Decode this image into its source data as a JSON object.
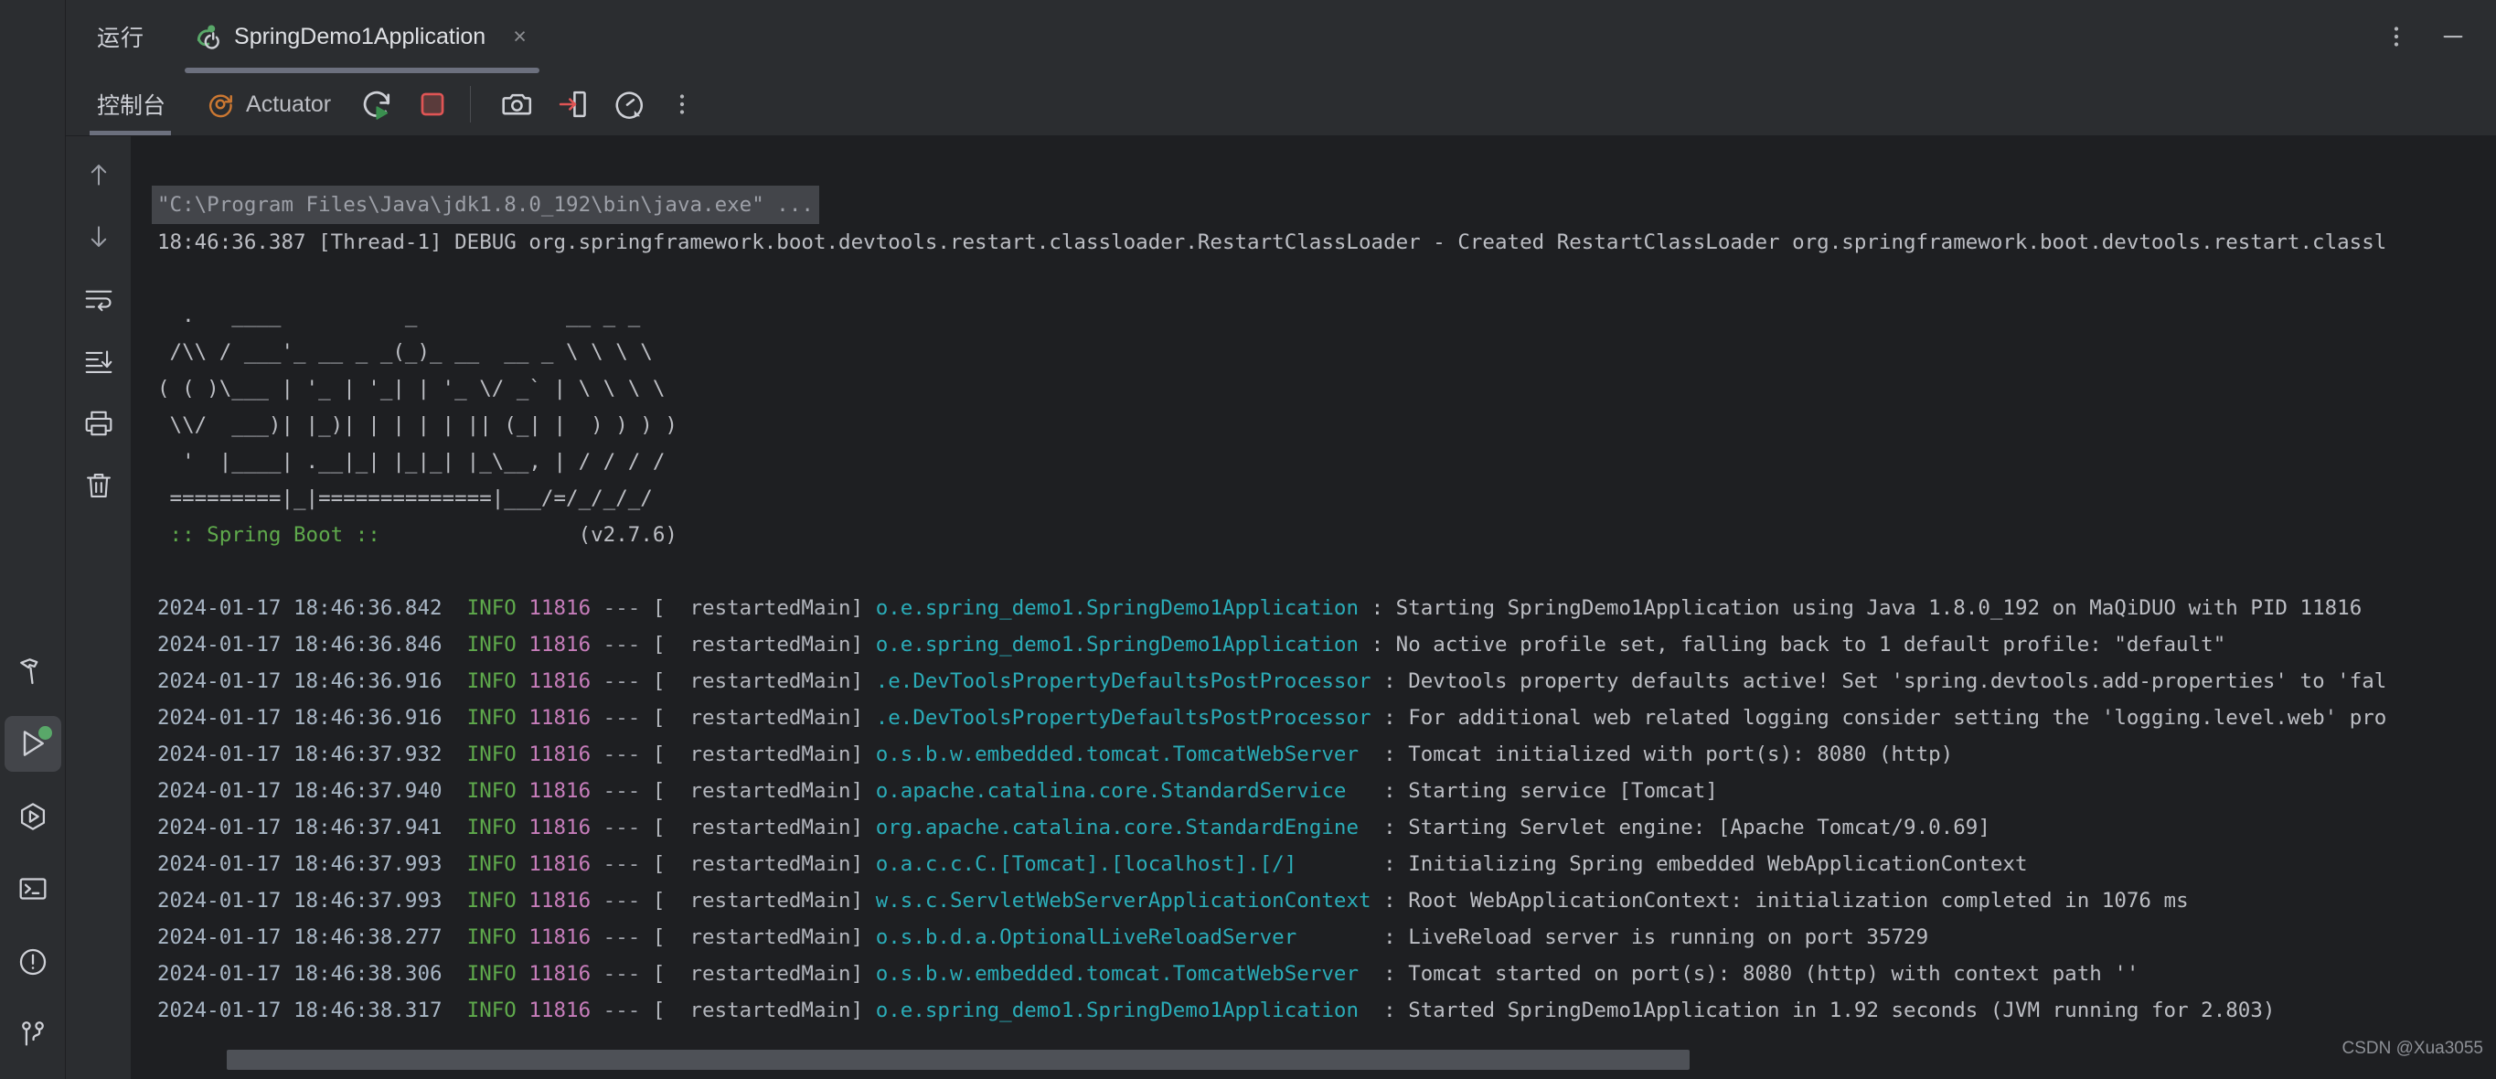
{
  "window": {
    "tool_window_title": "运行",
    "tab_label": "SpringDemo1Application",
    "tab_close_label": "×",
    "more_options_label": "⋮",
    "minimize_label": "—"
  },
  "left_toolbar": {
    "items": [
      {
        "name": "build-icon",
        "label": "构建"
      },
      {
        "name": "run-icon",
        "label": "运行",
        "active": true,
        "indicator": "#59a869"
      },
      {
        "name": "debug-icon",
        "label": "调试"
      },
      {
        "name": "terminal-icon",
        "label": "终端"
      },
      {
        "name": "problems-icon",
        "label": "问题"
      },
      {
        "name": "git-icon",
        "label": "Git"
      }
    ]
  },
  "action_bar": {
    "console_tab_label": "控制台",
    "actuator_tab_label": "Actuator",
    "buttons": [
      {
        "name": "rerun-button",
        "label": "重新运行"
      },
      {
        "name": "stop-button",
        "label": "停止",
        "color": "#e05555"
      },
      {
        "name": "screenshot-button",
        "label": "屏幕截图"
      },
      {
        "name": "export-button",
        "label": "导出",
        "color": "#e05555"
      },
      {
        "name": "dashboard-button",
        "label": "性能面板"
      },
      {
        "name": "more-button",
        "label": "更多"
      }
    ]
  },
  "console_gutter": {
    "buttons": [
      {
        "name": "up-arrow-icon",
        "label": "上一行"
      },
      {
        "name": "down-arrow-icon",
        "label": "下一行"
      },
      {
        "name": "soft-wrap-icon",
        "label": "软换行"
      },
      {
        "name": "scroll-to-end-icon",
        "label": "滚动到末尾"
      },
      {
        "name": "print-icon",
        "label": "打印"
      },
      {
        "name": "trash-icon",
        "label": "清空"
      }
    ]
  },
  "console": {
    "command_line": "\"C:\\Program Files\\Java\\jdk1.8.0_192\\bin\\java.exe\" ...",
    "debug_line": "18:46:36.387 [Thread-1] DEBUG org.springframework.boot.devtools.restart.classloader.RestartClassLoader - Created RestartClassLoader org.springframework.boot.devtools.restart.classl",
    "banner": [
      "  .   ____          _            __ _ _",
      " /\\\\ / ___'_ __ _ _(_)_ __  __ _ \\ \\ \\ \\",
      "( ( )\\___ | '_ | '_| | '_ \\/ _` | \\ \\ \\ \\",
      " \\\\/  ___)| |_)| | | | | || (_| |  ) ) ) )",
      "  '  |____| .__|_| |_|_| |_\\__, | / / / /",
      " =========|_|==============|___/=/_/_/_/"
    ],
    "banner_name": " :: Spring Boot :: ",
    "banner_version": "               (v2.7.6)",
    "lines": [
      {
        "timestamp": "2024-01-17 18:46:36.842",
        "level": "INFO",
        "pid": "11816",
        "dashes": "---",
        "thread": "[  restartedMain]",
        "logger": "o.e.spring_demo1.SpringDemo1Application",
        "message": ": Starting SpringDemo1Application using Java 1.8.0_192 on MaQiDUO with PID 11816"
      },
      {
        "timestamp": "2024-01-17 18:46:36.846",
        "level": "INFO",
        "pid": "11816",
        "dashes": "---",
        "thread": "[  restartedMain]",
        "logger": "o.e.spring_demo1.SpringDemo1Application",
        "message": ": No active profile set, falling back to 1 default profile: \"default\""
      },
      {
        "timestamp": "2024-01-17 18:46:36.916",
        "level": "INFO",
        "pid": "11816",
        "dashes": "---",
        "thread": "[  restartedMain]",
        "logger": ".e.DevToolsPropertyDefaultsPostProcessor",
        "message": ": Devtools property defaults active! Set 'spring.devtools.add-properties' to 'fal"
      },
      {
        "timestamp": "2024-01-17 18:46:36.916",
        "level": "INFO",
        "pid": "11816",
        "dashes": "---",
        "thread": "[  restartedMain]",
        "logger": ".e.DevToolsPropertyDefaultsPostProcessor",
        "message": ": For additional web related logging consider setting the 'logging.level.web' pro"
      },
      {
        "timestamp": "2024-01-17 18:46:37.932",
        "level": "INFO",
        "pid": "11816",
        "dashes": "---",
        "thread": "[  restartedMain]",
        "logger": "o.s.b.w.embedded.tomcat.TomcatWebServer ",
        "message": ": Tomcat initialized with port(s): 8080 (http)"
      },
      {
        "timestamp": "2024-01-17 18:46:37.940",
        "level": "INFO",
        "pid": "11816",
        "dashes": "---",
        "thread": "[  restartedMain]",
        "logger": "o.apache.catalina.core.StandardService  ",
        "message": ": Starting service [Tomcat]"
      },
      {
        "timestamp": "2024-01-17 18:46:37.941",
        "level": "INFO",
        "pid": "11816",
        "dashes": "---",
        "thread": "[  restartedMain]",
        "logger": "org.apache.catalina.core.StandardEngine ",
        "message": ": Starting Servlet engine: [Apache Tomcat/9.0.69]"
      },
      {
        "timestamp": "2024-01-17 18:46:37.993",
        "level": "INFO",
        "pid": "11816",
        "dashes": "---",
        "thread": "[  restartedMain]",
        "logger": "o.a.c.c.C.[Tomcat].[localhost].[/]      ",
        "message": ": Initializing Spring embedded WebApplicationContext"
      },
      {
        "timestamp": "2024-01-17 18:46:37.993",
        "level": "INFO",
        "pid": "11816",
        "dashes": "---",
        "thread": "[  restartedMain]",
        "logger": "w.s.c.ServletWebServerApplicationContext",
        "message": ": Root WebApplicationContext: initialization completed in 1076 ms"
      },
      {
        "timestamp": "2024-01-17 18:46:38.277",
        "level": "INFO",
        "pid": "11816",
        "dashes": "---",
        "thread": "[  restartedMain]",
        "logger": "o.s.b.d.a.OptionalLiveReloadServer      ",
        "message": ": LiveReload server is running on port 35729"
      },
      {
        "timestamp": "2024-01-17 18:46:38.306",
        "level": "INFO",
        "pid": "11816",
        "dashes": "---",
        "thread": "[  restartedMain]",
        "logger": "o.s.b.w.embedded.tomcat.TomcatWebServer ",
        "message": ": Tomcat started on port(s): 8080 (http) with context path ''"
      },
      {
        "timestamp": "2024-01-17 18:46:38.317",
        "level": "INFO",
        "pid": "11816",
        "dashes": "---",
        "thread": "[  restartedMain]",
        "logger": "o.e.spring_demo1.SpringDemo1Application ",
        "message": ": Started SpringDemo1Application in 1.92 seconds (JVM running for 2.803)"
      }
    ]
  },
  "watermark": "CSDN @Xua3055",
  "colors": {
    "background": "#1e1f22",
    "panel": "#2b2d30",
    "level_info": "#5faa4c",
    "logger": "#2aacb8",
    "pid": "#c77dbb",
    "stop": "#e05555",
    "actuator": "#cc7832",
    "run_indicator": "#59a869"
  }
}
